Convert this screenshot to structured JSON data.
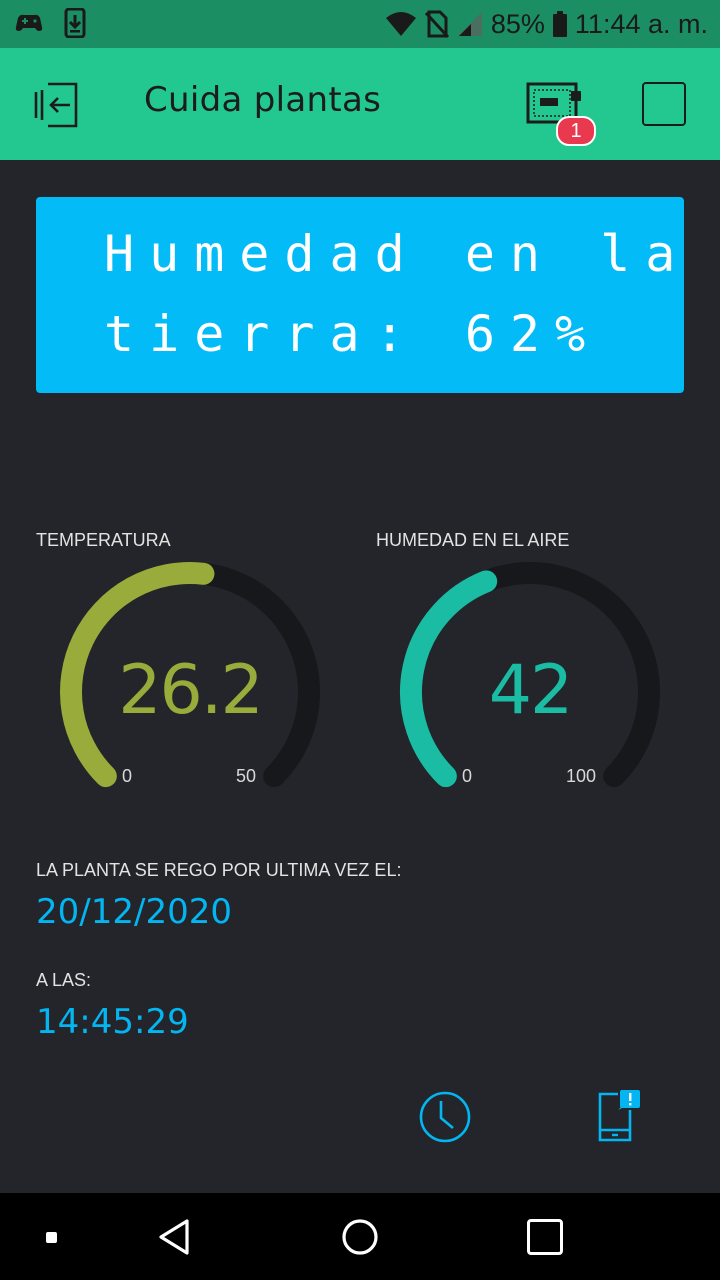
{
  "status_bar": {
    "battery": "85%",
    "time": "11:44 a. m.",
    "icons": [
      "game-controller-icon",
      "download-icon",
      "wifi-icon",
      "no-sim-icon",
      "signal-icon",
      "battery-icon"
    ]
  },
  "app_bar": {
    "title": "Cuida plantas",
    "device_badge": "1",
    "icons": [
      "exit-icon",
      "device-icon",
      "stop-square-icon"
    ]
  },
  "lcd": {
    "line1": "Humedad en la",
    "line2": "tierra: 62%"
  },
  "gauges": [
    {
      "label": "TEMPERATURA",
      "value": "26.2",
      "numeric": 26.2,
      "min": "0",
      "max": "50",
      "min_num": 0,
      "max_num": 50,
      "color": "#99ab3a"
    },
    {
      "label": "HUMEDAD EN EL AIRE",
      "value": "42",
      "numeric": 42,
      "min": "0",
      "max": "100",
      "min_num": 0,
      "max_num": 100,
      "color": "#1abca4"
    }
  ],
  "last_watered": {
    "label": "LA PLANTA SE REGO POR ULTIMA VEZ EL:",
    "date": "20/12/2020",
    "time_label": "A LAS:",
    "time": "14:45:29"
  },
  "bottom_icons": [
    "clock-icon",
    "phone-notification-icon"
  ],
  "nav_bar": {
    "icons": [
      "recent-dot-icon",
      "back-icon",
      "home-icon",
      "overview-icon"
    ]
  },
  "colors": {
    "accent": "#23c890",
    "status_bar": "#1b8f63",
    "background": "#23252b",
    "lcd": "#03bbf6",
    "value_blue": "#03b5f0",
    "gauge_track": "#17181c"
  }
}
